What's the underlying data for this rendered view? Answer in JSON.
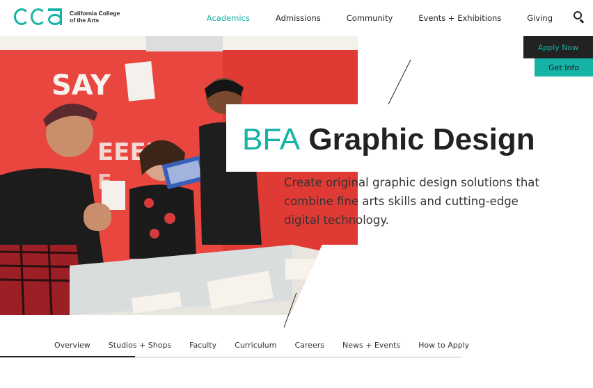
{
  "header": {
    "logo": {
      "mark": "CCA",
      "name_line1": "California College",
      "name_line2": "of the Arts"
    },
    "nav": [
      {
        "label": "Academics",
        "active": true
      },
      {
        "label": "Admissions",
        "active": false
      },
      {
        "label": "Community",
        "active": false
      },
      {
        "label": "Events + Exhibitions",
        "active": false
      },
      {
        "label": "Giving",
        "active": false
      }
    ],
    "search_icon": "search-icon"
  },
  "cta": {
    "apply_label": "Apply Now",
    "info_label": "Get Info"
  },
  "hero": {
    "degree": "BFA",
    "program": "Graphic Design",
    "description": "Create original graphic design solutions that combine fine arts skills and cutting-edge digital technology."
  },
  "subnav": {
    "items": [
      {
        "label": "Overview"
      },
      {
        "label": "Studios + Shops"
      },
      {
        "label": "Faculty"
      },
      {
        "label": "Curriculum"
      },
      {
        "label": "Careers"
      },
      {
        "label": "News + Events"
      },
      {
        "label": "How to Apply"
      }
    ]
  },
  "colors": {
    "accent": "#14b3a6",
    "dark": "#222222",
    "wall_red": "#e9463f"
  }
}
